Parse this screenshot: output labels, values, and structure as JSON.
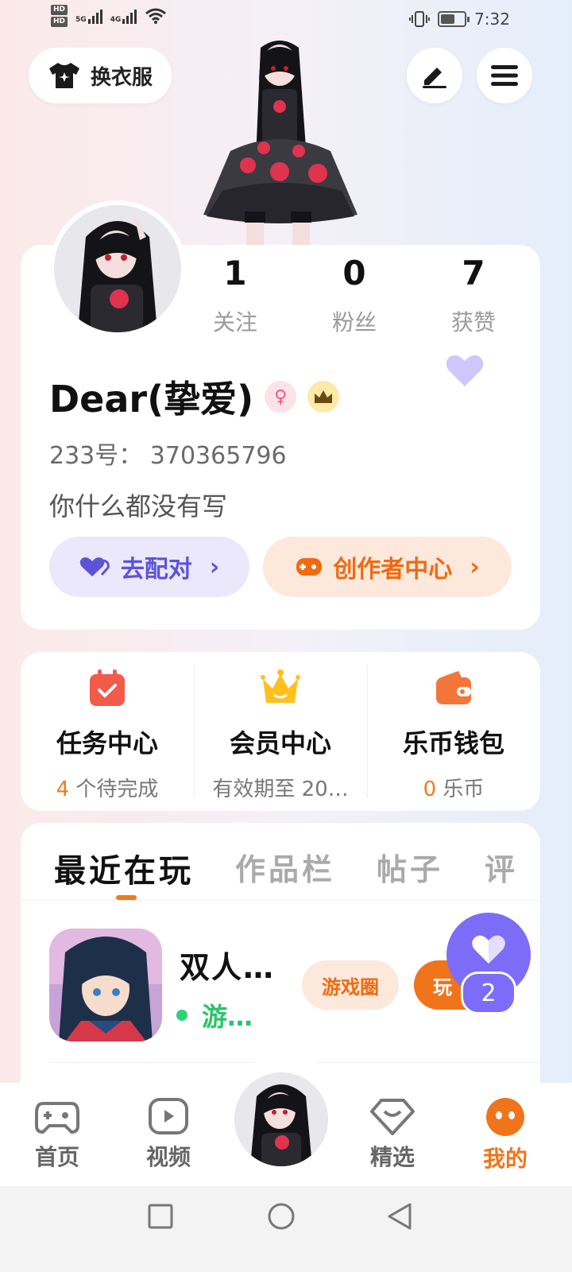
{
  "status_bar": {
    "hd1": "HD",
    "hd2": "HD",
    "net1": "5G",
    "net2": "4G",
    "time": "7:32",
    "battery_level": 0.6
  },
  "top": {
    "change_outfit_label": "换衣服",
    "icons": {
      "outfit": "tshirt-sparkle-icon",
      "edit": "pen-icon",
      "menu": "hamburger-menu-icon"
    }
  },
  "profile": {
    "stats": [
      {
        "value": "1",
        "label": "关注"
      },
      {
        "value": "0",
        "label": "粉丝"
      },
      {
        "value": "7",
        "label": "获赞"
      }
    ],
    "name": "Dear(挚爱)",
    "gender_badge": "♀",
    "uid": "233号： 370365796",
    "bio": "你什么都没有写",
    "match_button": "去配对",
    "creator_button": "创作者中心",
    "chevron": "›"
  },
  "services": [
    {
      "title": "任务中心",
      "sub_prefix": "4",
      "sub_suffix": " 个待完成",
      "icon": "calendar-check-icon"
    },
    {
      "title": "会员中心",
      "sub_prefix": "",
      "sub_suffix": "有效期至 20…",
      "icon": "crown-icon"
    },
    {
      "title": "乐币钱包",
      "sub_prefix": "0",
      "sub_suffix": " 乐币",
      "icon": "wallet-icon"
    }
  ],
  "tabs": [
    "最近在玩",
    "作品栏",
    "帖子",
    "评"
  ],
  "recent_game": {
    "title": "双人…",
    "status": "游…",
    "circle_button": "游戏圈",
    "play_button": "玩"
  },
  "float_like": {
    "count": "2"
  },
  "bottom_nav": [
    {
      "label": "首页",
      "icon": "gamepad-icon"
    },
    {
      "label": "视频",
      "icon": "video-play-icon"
    },
    {
      "label": "精选",
      "icon": "heart-diamond-icon"
    },
    {
      "label": "我的",
      "icon": "face-icon"
    }
  ],
  "colors": {
    "accent": "#f0741a",
    "purple": "#7c6cf7",
    "green": "#2cd27a"
  }
}
